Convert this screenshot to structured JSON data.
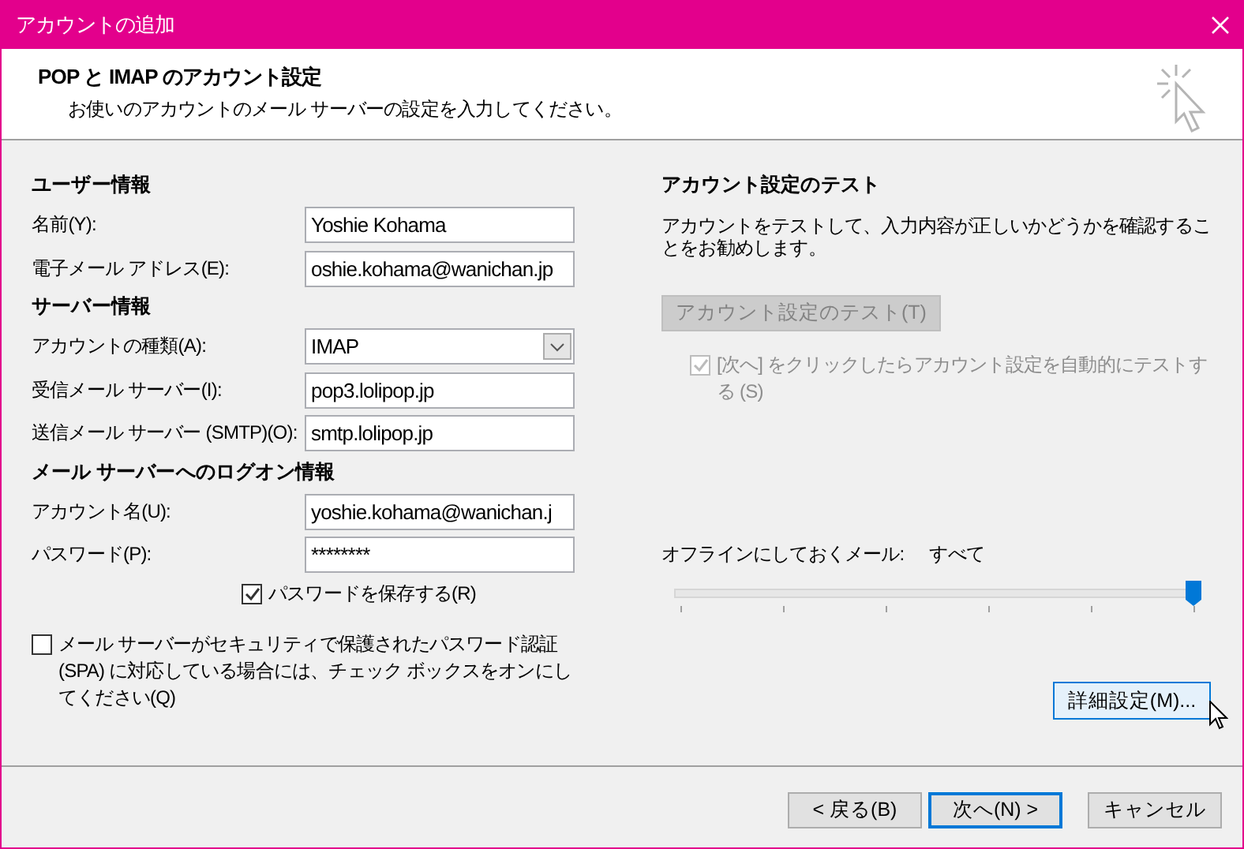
{
  "window": {
    "title": "アカウントの追加"
  },
  "header": {
    "title": "POP と IMAP のアカウント設定",
    "subtitle": "お使いのアカウントのメール サーバーの設定を入力してください。"
  },
  "left": {
    "sections": [
      {
        "heading": "ユーザー情報",
        "fields": [
          {
            "kind": "text",
            "label": "名前(Y):",
            "value": "Yoshie Kohama"
          },
          {
            "kind": "text",
            "label": "電子メール アドレス(E):",
            "value": "oshie.kohama@wanichan.jp"
          }
        ]
      },
      {
        "heading": "サーバー情報",
        "fields": [
          {
            "kind": "select",
            "label": "アカウントの種類(A):",
            "value": "IMAP"
          },
          {
            "kind": "text",
            "label": "受信メール サーバー(I):",
            "value": "pop3.lolipop.jp"
          },
          {
            "kind": "text",
            "label": "送信メール サーバー (SMTP)(O):",
            "value": "smtp.lolipop.jp"
          }
        ]
      },
      {
        "heading": "メール サーバーへのログオン情報",
        "fields": [
          {
            "kind": "text",
            "label": "アカウント名(U):",
            "value": "yoshie.kohama@wanichan.j"
          },
          {
            "kind": "password",
            "label": "パスワード(P):",
            "value": "********"
          }
        ]
      }
    ],
    "save_password": {
      "label": "パスワードを保存する(R)",
      "checked": true
    },
    "spa": {
      "label": "メール サーバーがセキュリティで保護されたパスワード認証 (SPA) に対応している場合には、チェック ボックスをオンにしてください(Q)",
      "checked": false
    }
  },
  "right": {
    "heading": "アカウント設定のテスト",
    "description": "アカウントをテストして、入力内容が正しいかどうかを確認することをお勧めします。",
    "test_button": {
      "label": "アカウント設定のテスト(T)",
      "disabled": true
    },
    "auto_test": {
      "label": "[次へ] をクリックしたらアカウント設定を自動的にテストする (S)",
      "checked": true,
      "disabled": true
    },
    "offline": {
      "label": "オフラインにしておくメール:",
      "value": "すべて",
      "level": 1
    },
    "advanced_button": "詳細設定(M)..."
  },
  "buttons": [
    {
      "label": "< 戻る(B)",
      "default": false
    },
    {
      "label": "次へ(N) >",
      "default": true
    },
    {
      "label": "キャンセル",
      "default": false
    }
  ]
}
